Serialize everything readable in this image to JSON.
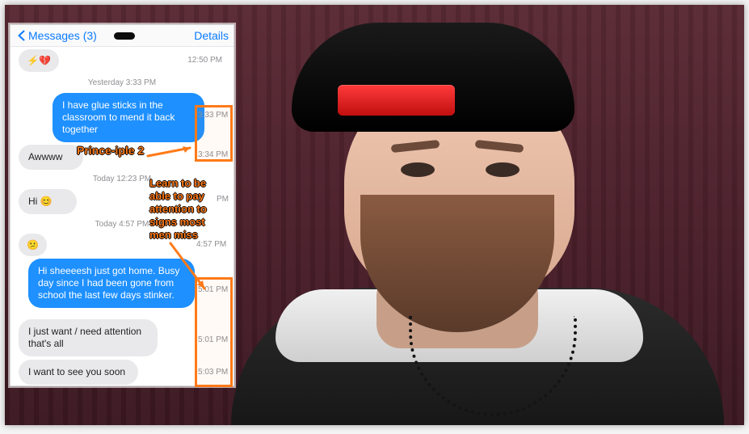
{
  "phone": {
    "back_label": "Messages (3)",
    "details_label": "Details",
    "header_time": "12:50 PM",
    "yesterday_time": "Yesterday 3:33 PM",
    "msg_out_1": "I have glue sticks in the classroom to mend it back together",
    "time_out_1": "3:33 PM",
    "msg_in_1": "Awwww",
    "time_in_1": "3:34 PM",
    "today_time_1": "Today 12:23 PM",
    "msg_in_2": "Hi 😊",
    "time_in_2": "PM",
    "today_time_2": "Today 4:57 PM",
    "time_in_3": "4:57 PM",
    "msg_out_2": "Hi sheeeesh just got home. Busy day since I had been gone from school the last few days stinker.",
    "time_out_2": "5:01 PM",
    "msg_in_4": "I just want / need attention that's all",
    "time_in_4": "5:01 PM",
    "msg_in_5": "I want to see you soon",
    "time_in_5": "5:03 PM"
  },
  "annotations": {
    "principle": "Prince-iple 2",
    "learn_lines": [
      "Learn to be",
      "able to pay",
      "attention to",
      "signs most",
      "men miss"
    ]
  },
  "colors": {
    "accent_orange": "#ff7a18",
    "ios_blue": "#0a7aff",
    "bubble_blue": "#1e90ff",
    "bubble_gray": "#e9e9eb",
    "background_curtain": "#4a1f2a"
  },
  "icons": {
    "chevron": "chevron-left-icon",
    "emoji": "emoji-icon",
    "arrow": "arrow-icon"
  }
}
